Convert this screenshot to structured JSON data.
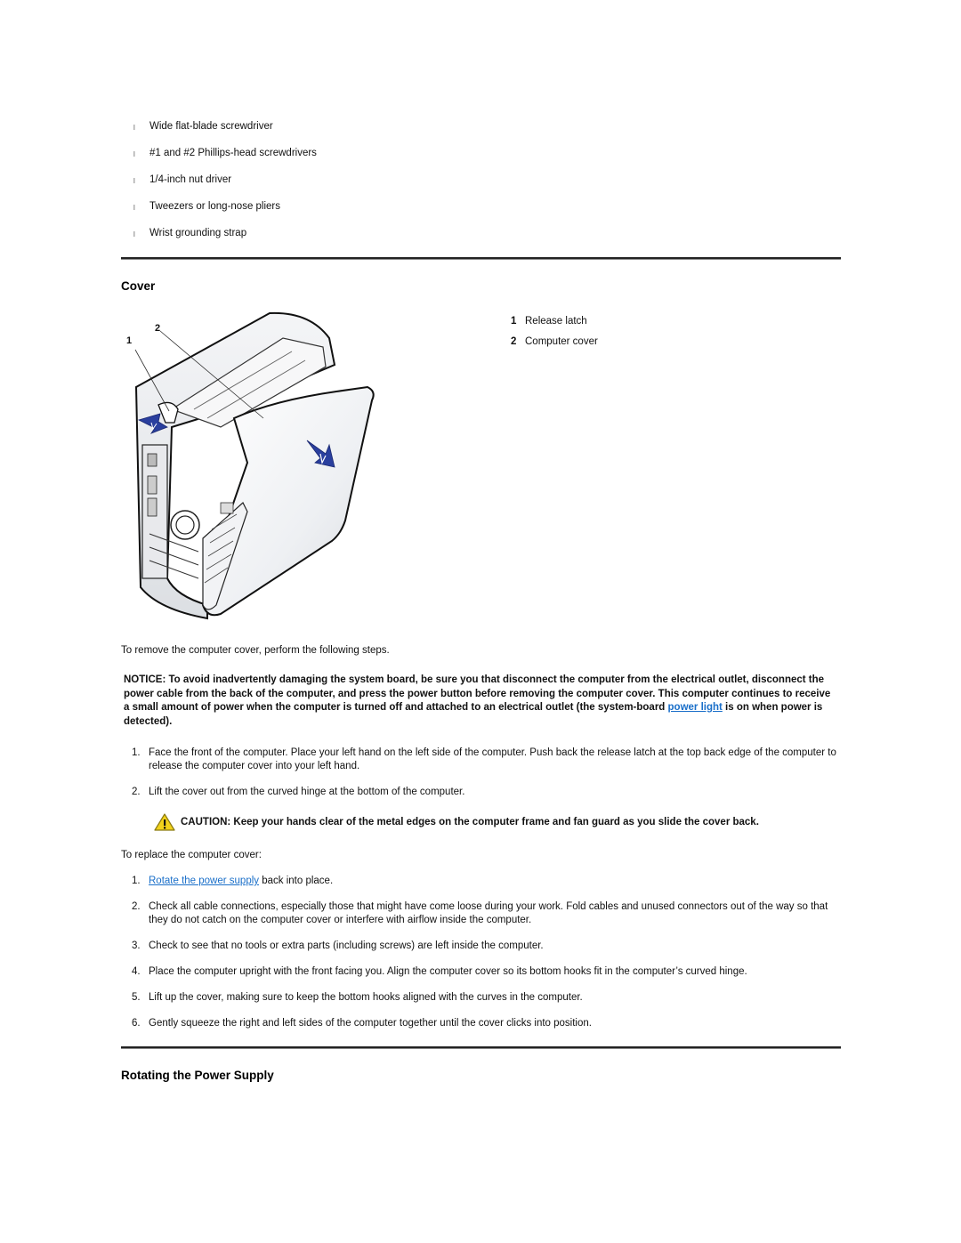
{
  "tools": {
    "bullet_glyph": "l",
    "items": [
      "Wide flat-blade screwdriver",
      "#1 and #2 Phillips-head screwdrivers",
      "1/4-inch nut driver",
      "Tweezers or long-nose pliers",
      "Wrist grounding strap"
    ]
  },
  "cover_section": {
    "title": "Cover",
    "figure": {
      "callout_1": "1",
      "callout_2": "2",
      "arrow_color": "#2a3f9e",
      "legend": [
        {
          "num": "1",
          "label": "Release latch"
        },
        {
          "num": "2",
          "label": "Computer cover"
        }
      ]
    },
    "intro": "To remove the computer cover, perform the following steps.",
    "notice": {
      "before_link": "NOTICE: To avoid inadvertently damaging the system board, be sure you that disconnect the computer from the electrical outlet, disconnect the power cable from the back of the computer, and press the power button before removing the computer cover. This computer continues to receive a small amount of power when the computer is turned off and attached to an electrical outlet (the system-board ",
      "link": "power light",
      "after_link": " is on when power is detected)."
    },
    "remove_steps": [
      {
        "n": "1.",
        "text": "Face the front of the computer. Place your left hand on the left side of the computer. Push back the release latch at the top back edge of the computer to release the computer cover into your left hand."
      },
      {
        "n": "2.",
        "text": "Lift the cover out from the curved hinge at the bottom of the computer."
      }
    ],
    "caution": {
      "icon": "warning-triangle-icon",
      "text": "CAUTION: Keep your hands clear of the metal edges on the computer frame and fan guard as you slide the cover back."
    },
    "replace_intro": "To replace the computer cover:",
    "replace_steps": [
      {
        "n": "1.",
        "link": "Rotate the power supply",
        "text": " back into place."
      },
      {
        "n": "2.",
        "text": "Check all cable connections, especially those that might have come loose during your work. Fold cables and unused connectors out of the way so that they do not catch on the computer cover or interfere with airflow inside the computer."
      },
      {
        "n": "3.",
        "text": "Check to see that no tools or extra parts (including screws) are left inside the computer."
      },
      {
        "n": "4.",
        "text": "Place the computer upright with the front facing you. Align the computer cover so its bottom hooks fit in the computer’s curved hinge."
      },
      {
        "n": "5.",
        "text": "Lift up the cover, making sure to keep the bottom hooks aligned with the curves in the computer."
      },
      {
        "n": "6.",
        "text": "Gently squeeze the right and left sides of the computer together until the cover clicks into position."
      }
    ]
  },
  "next_section": {
    "title": "Rotating the Power Supply"
  },
  "colors": {
    "link": "#1a6fc9",
    "rule": "#222222",
    "warning_fill": "#f2d21b"
  }
}
